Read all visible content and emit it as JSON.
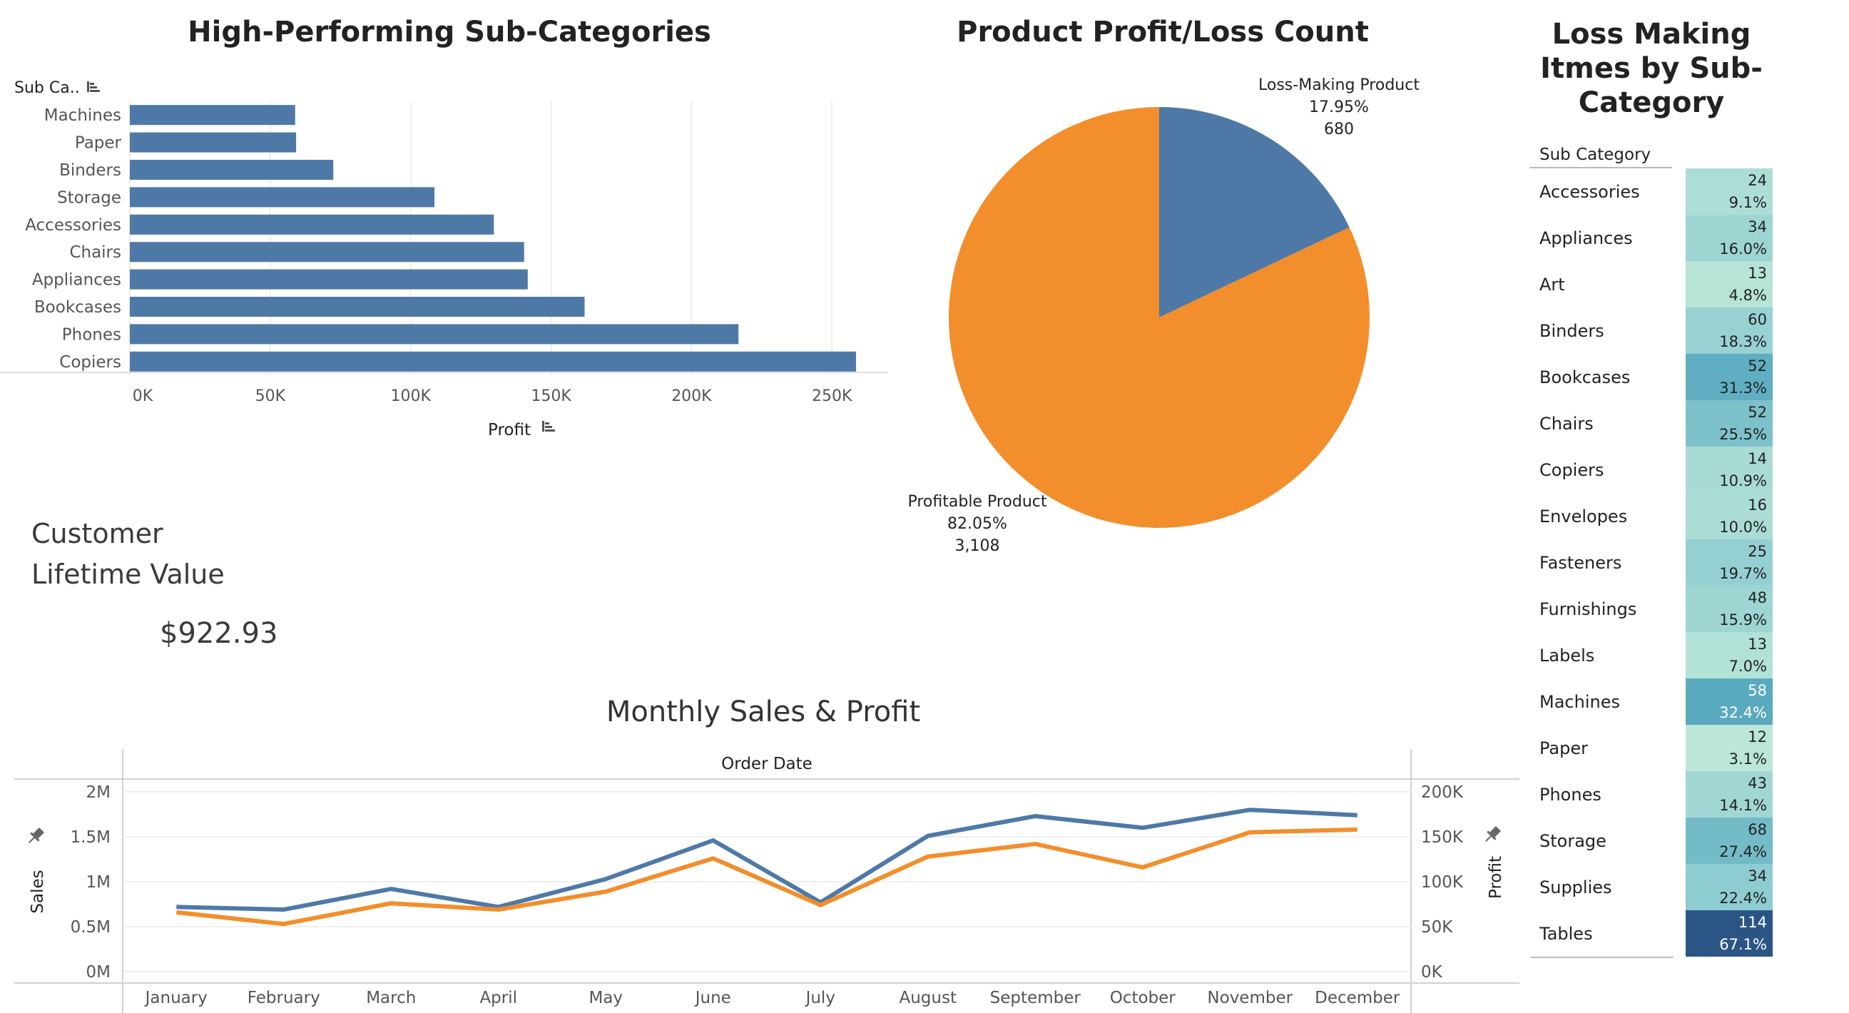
{
  "bar_title": "High-Performing Sub-Categories",
  "pie_title": "Product Profit/Loss Count",
  "loss_title_lines": [
    "Loss Making",
    "Itmes by Sub-",
    "Category"
  ],
  "clv": {
    "label_lines": [
      "Customer",
      "Lifetime Value"
    ],
    "value": "$922.93"
  },
  "line_title": "Monthly Sales & Profit",
  "colors": {
    "blue": "#4E79A7",
    "orange": "#F28E2B"
  },
  "chart_data": [
    {
      "type": "bar",
      "orientation": "horizontal",
      "title": "High-Performing Sub-Categories",
      "y_header": "Sub Ca..",
      "xlabel": "Profit",
      "categories": [
        "Machines",
        "Paper",
        "Binders",
        "Storage",
        "Accessories",
        "Chairs",
        "Appliances",
        "Bookcases",
        "Phones",
        "Copiers"
      ],
      "values": [
        58867,
        59207,
        72449,
        108461,
        129626,
        140396,
        141681,
        161925,
        216717,
        258567
      ],
      "xlim": [
        0,
        270000
      ],
      "xticks": [
        0,
        50000,
        100000,
        150000,
        200000,
        250000
      ],
      "xtick_labels": [
        "0K",
        "50K",
        "100K",
        "150K",
        "200K",
        "250K"
      ],
      "grid": true
    },
    {
      "type": "pie",
      "title": "Product Profit/Loss Count",
      "slices": [
        {
          "label": "Loss-Making Product",
          "percent": "17.95%",
          "count": "680",
          "value": 680,
          "color": "#4E79A7"
        },
        {
          "label": "Profitable Product",
          "percent": "82.05%",
          "count": "3,108",
          "value": 3108,
          "color": "#F28E2B"
        }
      ]
    },
    {
      "type": "table",
      "title": "Loss Making Itmes by Sub-Category",
      "column_header": "Sub Category",
      "rows": [
        {
          "name": "Accessories",
          "count": "24",
          "pct": "9.1%"
        },
        {
          "name": "Appliances",
          "count": "34",
          "pct": "16.0%"
        },
        {
          "name": "Art",
          "count": "13",
          "pct": "4.8%"
        },
        {
          "name": "Binders",
          "count": "60",
          "pct": "18.3%"
        },
        {
          "name": "Bookcases",
          "count": "52",
          "pct": "31.3%"
        },
        {
          "name": "Chairs",
          "count": "52",
          "pct": "25.5%"
        },
        {
          "name": "Copiers",
          "count": "14",
          "pct": "10.9%"
        },
        {
          "name": "Envelopes",
          "count": "16",
          "pct": "10.0%"
        },
        {
          "name": "Fasteners",
          "count": "25",
          "pct": "19.7%"
        },
        {
          "name": "Furnishings",
          "count": "48",
          "pct": "15.9%"
        },
        {
          "name": "Labels",
          "count": "13",
          "pct": "7.0%"
        },
        {
          "name": "Machines",
          "count": "58",
          "pct": "32.4%"
        },
        {
          "name": "Paper",
          "count": "12",
          "pct": "3.1%"
        },
        {
          "name": "Phones",
          "count": "43",
          "pct": "14.1%"
        },
        {
          "name": "Storage",
          "count": "68",
          "pct": "27.4%"
        },
        {
          "name": "Supplies",
          "count": "34",
          "pct": "22.4%"
        },
        {
          "name": "Tables",
          "count": "114",
          "pct": "67.1%"
        }
      ]
    },
    {
      "type": "line",
      "title": "Monthly Sales & Profit",
      "x_header": "Order Date",
      "categories": [
        "January",
        "February",
        "March",
        "April",
        "May",
        "June",
        "July",
        "August",
        "September",
        "October",
        "November",
        "December"
      ],
      "y_left": {
        "label": "Sales",
        "lim": [
          0,
          2000000
        ],
        "ticks": [
          0,
          500000,
          1000000,
          1500000,
          2000000
        ],
        "tick_labels": [
          "0M",
          "0.5M",
          "1M",
          "1.5M",
          "2M"
        ]
      },
      "y_right": {
        "label": "Profit",
        "lim": [
          0,
          200000
        ],
        "ticks": [
          0,
          50000,
          100000,
          150000,
          200000
        ],
        "tick_labels": [
          "0K",
          "50K",
          "100K",
          "150K",
          "200K"
        ]
      },
      "series": [
        {
          "name": "Sales",
          "axis": "left",
          "color": "#4E79A7",
          "values": [
            720000,
            690000,
            920000,
            720000,
            1030000,
            1460000,
            770000,
            1510000,
            1730000,
            1600000,
            1800000,
            1740000
          ]
        },
        {
          "name": "Profit",
          "axis": "right",
          "color": "#F28E2B",
          "values": [
            66000,
            53000,
            76000,
            69000,
            89000,
            126000,
            74000,
            128000,
            142000,
            116000,
            155000,
            158000
          ]
        }
      ],
      "grid": true
    }
  ]
}
